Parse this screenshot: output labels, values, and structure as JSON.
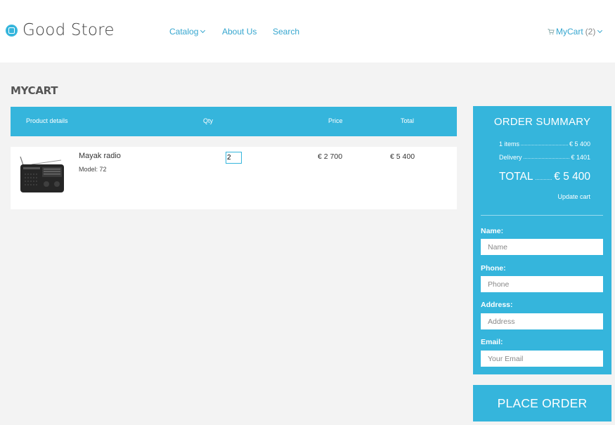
{
  "brand": {
    "name": "Good Store"
  },
  "nav": {
    "catalog": "Catalog",
    "about": "About Us",
    "search": "Search",
    "cart_label": "MyCart",
    "cart_count": "(2)"
  },
  "page": {
    "title": "MYCART"
  },
  "table": {
    "headers": {
      "product": "Product details",
      "qty": "Qty",
      "price": "Price",
      "total": "Total"
    },
    "rows": [
      {
        "name": "Mayak radio",
        "model": "Model: 72",
        "qty": "2",
        "price": "€ 2 700",
        "total": "€ 5 400"
      }
    ]
  },
  "summary": {
    "title": "ORDER SUMMARY",
    "items_label": "1 items",
    "items_value": "€ 5 400",
    "delivery_label": "Delivery",
    "delivery_value": "€ 1401",
    "total_label": "TOTAL",
    "total_value": "€ 5 400",
    "update": "Update cart"
  },
  "form": {
    "name_label": "Name:",
    "name_placeholder": "Name",
    "phone_label": "Phone:",
    "phone_placeholder": "Phone",
    "address_label": "Address:",
    "address_placeholder": "Address",
    "email_label": "Email:",
    "email_placeholder": "Your Email"
  },
  "place_order": "PLACE ORDER",
  "colors": {
    "accent": "#35b5dc",
    "link": "#35a6cf",
    "background": "#f3f3f3"
  },
  "icons": {
    "logo": "rounded-square-in-circle",
    "cart": "cart-icon",
    "dropdown": "chevron-down-icon"
  }
}
